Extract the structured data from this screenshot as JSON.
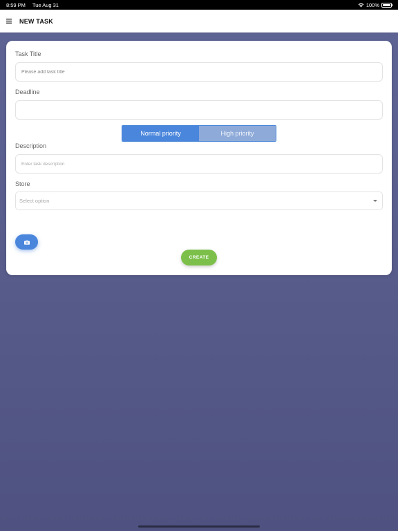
{
  "status_bar": {
    "time": "8:59 PM",
    "date": "Tue Aug 31",
    "battery": "100%",
    "battery_level": 1.0
  },
  "app_bar": {
    "title": "NEW TASK",
    "menu_icon": "hamburger-menu-icon"
  },
  "form": {
    "task_title": {
      "label": "Task Title",
      "placeholder": "Please add task title",
      "value": ""
    },
    "deadline": {
      "label": "Deadline",
      "value": ""
    },
    "priority": {
      "options": [
        "Normal priority",
        "High priority"
      ],
      "selected": "Normal priority"
    },
    "description": {
      "label": "Description",
      "placeholder": "Enter task description",
      "value": ""
    },
    "store": {
      "label": "Store",
      "placeholder": "Select option"
    },
    "camera_button_icon": "camera-icon",
    "create_label": "CREATE"
  },
  "colors": {
    "primary": "#4a86dc",
    "primary_inactive": "#8eaad9",
    "create": "#7cc04b",
    "background": "#585d8c"
  }
}
